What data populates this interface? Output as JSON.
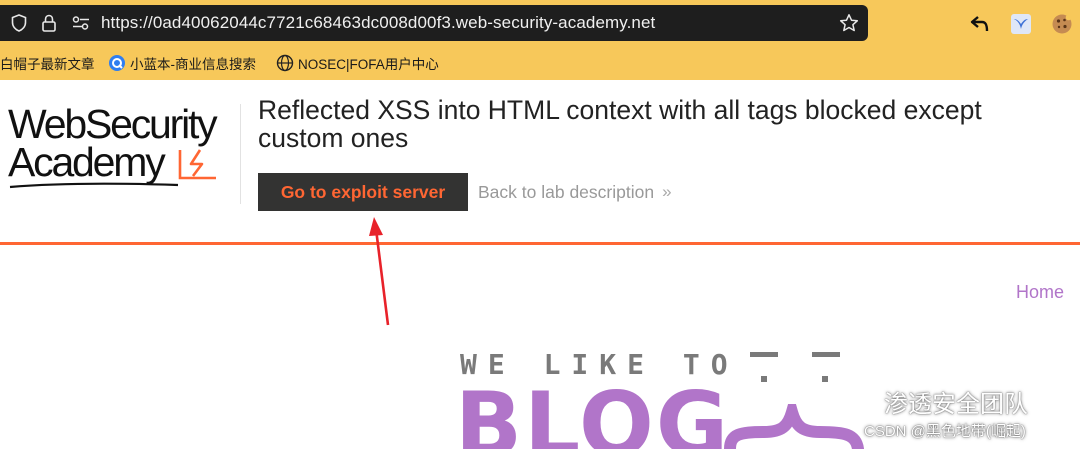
{
  "browser": {
    "url": "https://0ad40062044c7721c68463dc008d00f3.web-security-academy.net",
    "left_icons": [
      "shield-icon",
      "lock-icon",
      "permissions-icon"
    ],
    "right_icons": [
      "bookmark-star-icon",
      "undo-arrow-icon",
      "bird-extension-icon",
      "cookie-extension-icon"
    ],
    "bookmarks": [
      {
        "label": "白帽子最新文章",
        "icon": "none"
      },
      {
        "label": "小蓝本-商业信息搜索",
        "icon": "blue-q-icon"
      },
      {
        "label": "NOSEC|FOFA用户中心",
        "icon": "globe-icon"
      }
    ],
    "toolbar_color": "#f7c85a",
    "urlbar_color": "#1e1e1e"
  },
  "lab": {
    "logo_line1": "WebSecurity",
    "logo_line2": "Academy",
    "title": "Reflected XSS into HTML context with all tags blocked except custom ones",
    "exploit_button": "Go to exploit server",
    "back_link": "Back to lab description",
    "back_chevron": "»",
    "accent_color": "#ff6633"
  },
  "page": {
    "home_link": "Home",
    "tagline": "WE LIKE TO",
    "blog_word": "BLOG",
    "blog_color": "#b175c9"
  },
  "watermark": {
    "wechat_text": "渗透安全团队",
    "csdn_text": "CSDN @黑色地带(崛起)"
  }
}
